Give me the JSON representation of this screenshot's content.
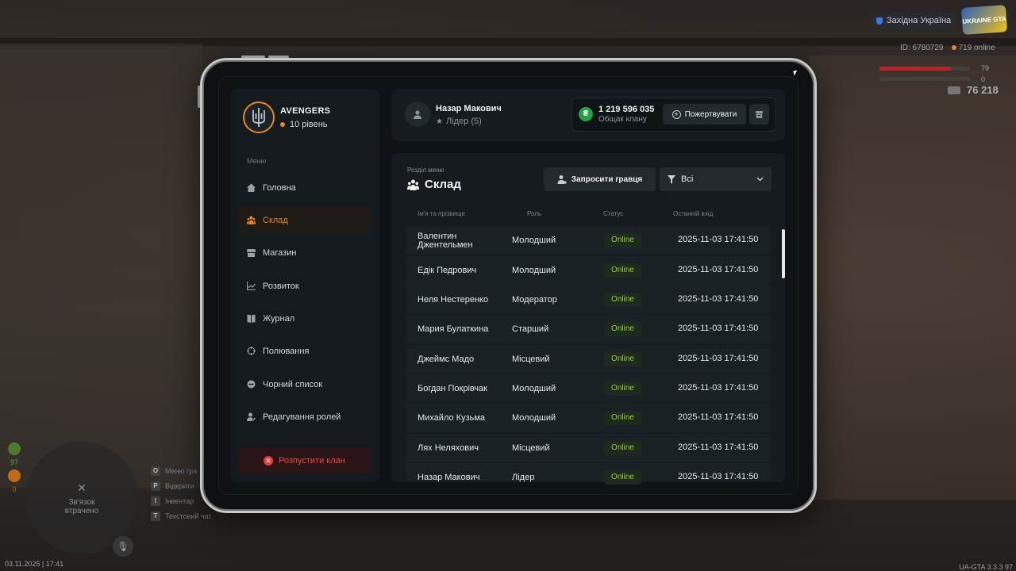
{
  "hud": {
    "region": "Західна Україна",
    "logo": "UKRAINE GTA",
    "player_id": "ID: 6780729",
    "online": "719 online",
    "health": "79",
    "armor": "0",
    "money": "76 218",
    "minimap_text": "Зв'язок втрачено",
    "mm_count_1": "97",
    "mm_count_2": "0",
    "keys": [
      {
        "key": "O",
        "label": "Меню гра"
      },
      {
        "key": "P",
        "label": "Відкрити"
      },
      {
        "key": "I",
        "label": "Інвентар"
      },
      {
        "key": "T",
        "label": "Текстовий чат"
      }
    ],
    "date": "03.11.2025 | 17:41",
    "version": "UA-GTA 3.3.3",
    "fps": "97"
  },
  "clan": {
    "name": "AVENGERS",
    "level": "10 рівень"
  },
  "menu": {
    "label": "Меню",
    "items": [
      {
        "label": "Головна",
        "icon": "home-icon"
      },
      {
        "label": "Склад",
        "icon": "users-icon"
      },
      {
        "label": "Магазин",
        "icon": "shop-icon"
      },
      {
        "label": "Розвиток",
        "icon": "chart-icon"
      },
      {
        "label": "Журнал",
        "icon": "book-icon"
      },
      {
        "label": "Полювання",
        "icon": "crosshair-icon"
      },
      {
        "label": "Чорний список",
        "icon": "block-icon"
      },
      {
        "label": "Редагування ролей",
        "icon": "user-edit-icon"
      }
    ],
    "active_index": 1,
    "disband_label": "Розпустити клан"
  },
  "user": {
    "name": "Назар Макович",
    "role": "Лідер (5)"
  },
  "funds": {
    "amount": "1 219 596 035",
    "label": "Общак клану",
    "donate_label": "Пожертвувати"
  },
  "section": {
    "label": "Розділ меню",
    "title": "Склад",
    "invite_label": "Запросити гравця",
    "filter_value": "Всі"
  },
  "table": {
    "headers": {
      "name": "Ім'я та прізвище",
      "role": "Роль",
      "status": "Статус",
      "last_login": "Останній вхід"
    },
    "rows": [
      {
        "name": "Валентин\nДжентельмен",
        "role": "Молодший",
        "status": "Online",
        "last_login": "2025-11-03 17:41:50"
      },
      {
        "name": "Едік Педрович",
        "role": "Молодший",
        "status": "Online",
        "last_login": "2025-11-03 17:41:50"
      },
      {
        "name": "Неля Нестеренко",
        "role": "Модератор",
        "status": "Online",
        "last_login": "2025-11-03 17:41:50"
      },
      {
        "name": "Мария Булаткина",
        "role": "Старший",
        "status": "Online",
        "last_login": "2025-11-03 17:41:50"
      },
      {
        "name": "Джеймс Мадо",
        "role": "Місцевий",
        "status": "Online",
        "last_login": "2025-11-03 17:41:50"
      },
      {
        "name": "Богдан Покрівчак",
        "role": "Молодший",
        "status": "Online",
        "last_login": "2025-11-03 17:41:50"
      },
      {
        "name": "Михайло Кузьма",
        "role": "Молодший",
        "status": "Online",
        "last_login": "2025-11-03 17:41:50"
      },
      {
        "name": "Лях Неляхович",
        "role": "Місцевий",
        "status": "Online",
        "last_login": "2025-11-03 17:41:50"
      },
      {
        "name": "Назар Макович",
        "role": "Лідер",
        "status": "Online",
        "last_login": "2025-11-03 17:41:50"
      }
    ]
  },
  "colors": {
    "accent": "#e7862b",
    "online": "#8fd13f",
    "danger": "#e84a4a",
    "coin": "#22a043"
  }
}
